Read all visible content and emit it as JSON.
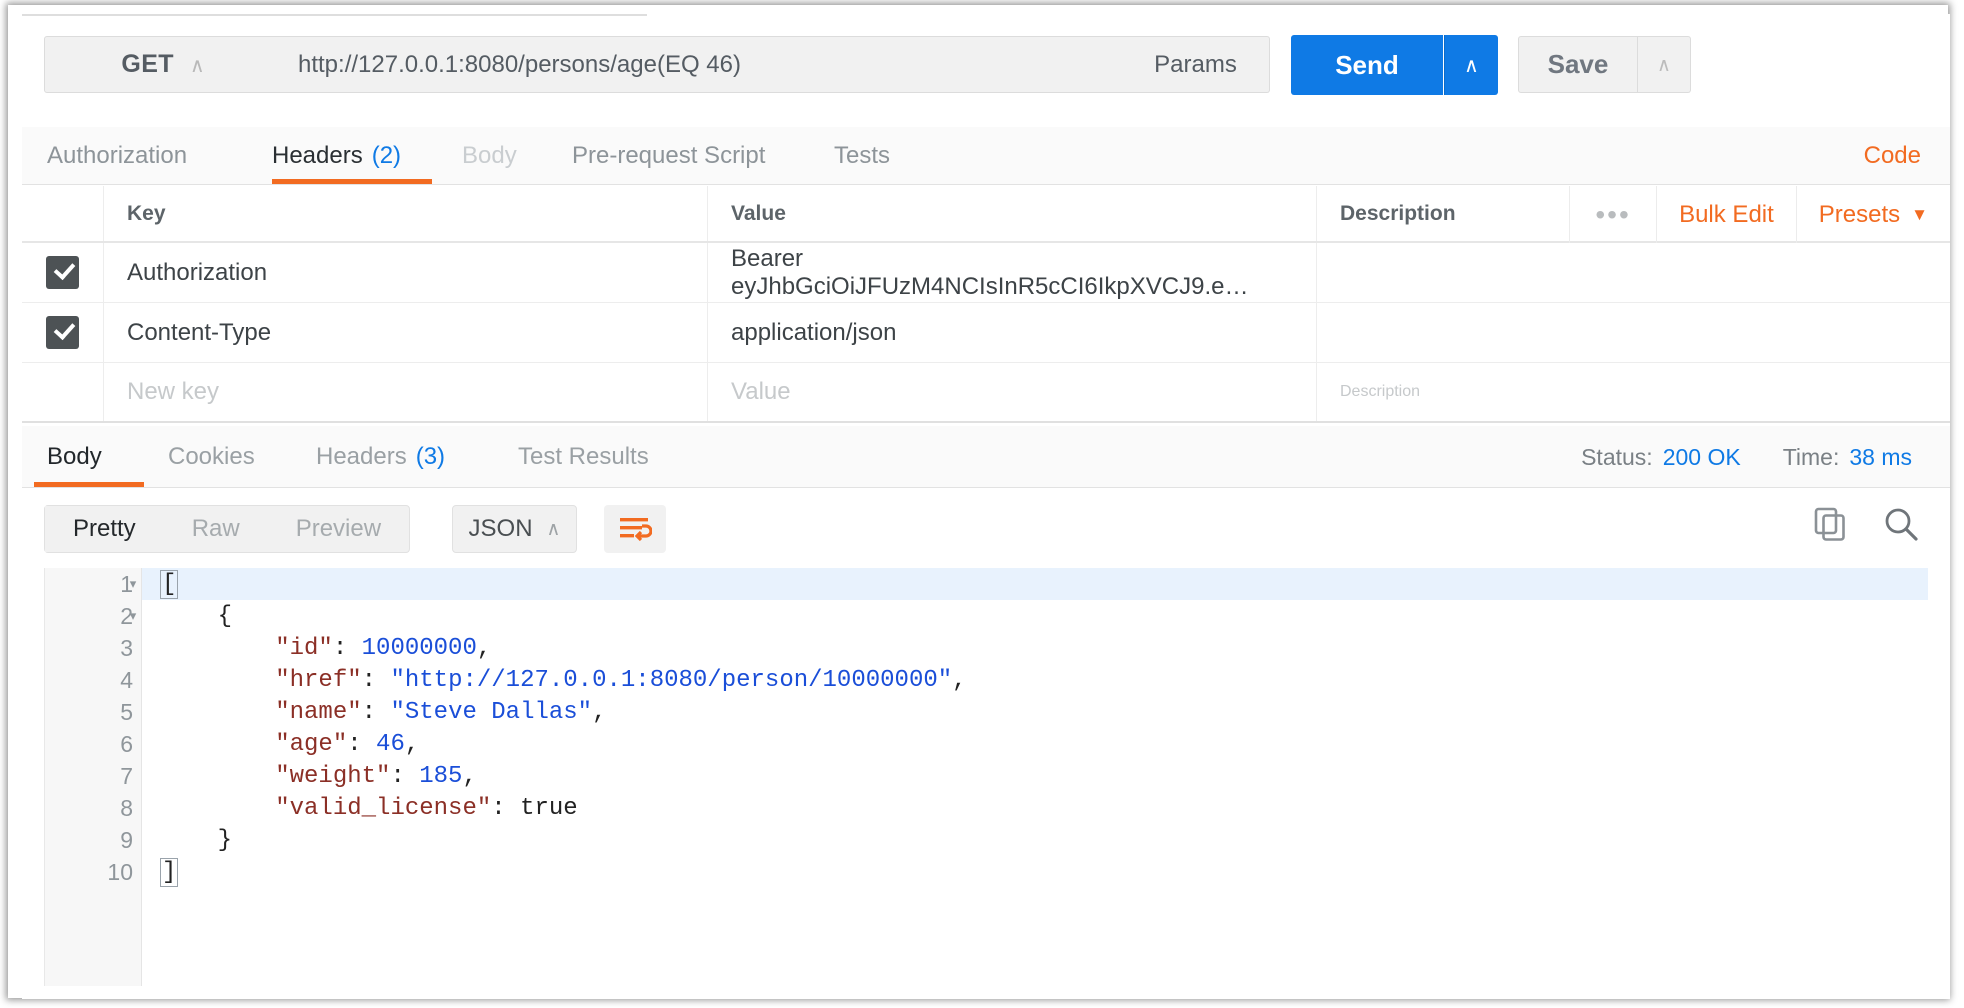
{
  "request": {
    "method": "GET",
    "url": "http://127.0.0.1:8080/persons/age(EQ 46)",
    "params_label": "Params",
    "send_label": "Send",
    "save_label": "Save",
    "tabs": [
      {
        "label": "Authorization",
        "count": "",
        "state": "normal"
      },
      {
        "label": "Headers",
        "count": "(2)",
        "state": "active"
      },
      {
        "label": "Body",
        "count": "",
        "state": "disabled"
      },
      {
        "label": "Pre-request Script",
        "count": "",
        "state": "normal"
      },
      {
        "label": "Tests",
        "count": "",
        "state": "normal"
      }
    ],
    "code_link": "Code"
  },
  "headers_table": {
    "columns": [
      "Key",
      "Value",
      "Description"
    ],
    "rows": [
      {
        "checked": true,
        "key": "Authorization",
        "value": "Bearer eyJhbGciOiJFUzM4NCIsInR5cCI6IkpXVCJ9.e…",
        "description": ""
      },
      {
        "checked": true,
        "key": "Content-Type",
        "value": "application/json",
        "description": ""
      }
    ],
    "new_row": {
      "key_placeholder": "New key",
      "value_placeholder": "Value",
      "description_placeholder": "Description"
    },
    "tools": {
      "more_dots": "•••",
      "bulk_edit": "Bulk Edit",
      "presets": "Presets",
      "presets_caret": "▼"
    }
  },
  "response": {
    "tabs": [
      {
        "label": "Body",
        "count": "",
        "state": "active"
      },
      {
        "label": "Cookies",
        "count": "",
        "state": "normal"
      },
      {
        "label": "Headers",
        "count": "(3)",
        "state": "normal"
      },
      {
        "label": "Test Results",
        "count": "",
        "state": "normal"
      }
    ],
    "status_label": "Status:",
    "status_value": "200 OK",
    "time_label": "Time:",
    "time_value": "38 ms",
    "view_modes": [
      "Pretty",
      "Raw",
      "Preview"
    ],
    "active_view_mode": "Pretty",
    "format": "JSON",
    "icons": {
      "wrap": "word-wrap-icon",
      "copy": "copy-icon",
      "search": "search-icon"
    }
  },
  "code": {
    "language": "json",
    "lines": [
      {
        "no": "1",
        "fold": "▾",
        "highlight": true,
        "tokens": [
          {
            "t": "[",
            "c": "cursor"
          }
        ]
      },
      {
        "no": "2",
        "fold": "▾",
        "highlight": false,
        "tokens": [
          {
            "t": "    {",
            "c": "p"
          }
        ]
      },
      {
        "no": "3",
        "fold": "",
        "highlight": false,
        "tokens": [
          {
            "t": "        ",
            "c": "p"
          },
          {
            "t": "\"id\"",
            "c": "k"
          },
          {
            "t": ": ",
            "c": "p"
          },
          {
            "t": "10000000",
            "c": "n"
          },
          {
            "t": ",",
            "c": "p"
          }
        ]
      },
      {
        "no": "4",
        "fold": "",
        "highlight": false,
        "tokens": [
          {
            "t": "        ",
            "c": "p"
          },
          {
            "t": "\"href\"",
            "c": "k"
          },
          {
            "t": ": ",
            "c": "p"
          },
          {
            "t": "\"http://127.0.0.1:8080/person/10000000\"",
            "c": "s"
          },
          {
            "t": ",",
            "c": "p"
          }
        ]
      },
      {
        "no": "5",
        "fold": "",
        "highlight": false,
        "tokens": [
          {
            "t": "        ",
            "c": "p"
          },
          {
            "t": "\"name\"",
            "c": "k"
          },
          {
            "t": ": ",
            "c": "p"
          },
          {
            "t": "\"Steve Dallas\"",
            "c": "s"
          },
          {
            "t": ",",
            "c": "p"
          }
        ]
      },
      {
        "no": "6",
        "fold": "",
        "highlight": false,
        "tokens": [
          {
            "t": "        ",
            "c": "p"
          },
          {
            "t": "\"age\"",
            "c": "k"
          },
          {
            "t": ": ",
            "c": "p"
          },
          {
            "t": "46",
            "c": "n"
          },
          {
            "t": ",",
            "c": "p"
          }
        ]
      },
      {
        "no": "7",
        "fold": "",
        "highlight": false,
        "tokens": [
          {
            "t": "        ",
            "c": "p"
          },
          {
            "t": "\"weight\"",
            "c": "k"
          },
          {
            "t": ": ",
            "c": "p"
          },
          {
            "t": "185",
            "c": "n"
          },
          {
            "t": ",",
            "c": "p"
          }
        ]
      },
      {
        "no": "8",
        "fold": "",
        "highlight": false,
        "tokens": [
          {
            "t": "        ",
            "c": "p"
          },
          {
            "t": "\"valid_license\"",
            "c": "k"
          },
          {
            "t": ": ",
            "c": "p"
          },
          {
            "t": "true",
            "c": "b"
          }
        ]
      },
      {
        "no": "9",
        "fold": "",
        "highlight": false,
        "tokens": [
          {
            "t": "    }",
            "c": "p"
          }
        ]
      },
      {
        "no": "10",
        "fold": "",
        "highlight": false,
        "tokens": [
          {
            "t": "]",
            "c": "cursor"
          }
        ]
      }
    ],
    "json_value": [
      {
        "id": 10000000,
        "href": "http://127.0.0.1:8080/person/10000000",
        "name": "Steve Dallas",
        "age": 46,
        "weight": 185,
        "valid_license": true
      }
    ]
  },
  "colors": {
    "accent_orange": "#f26b21",
    "accent_blue": "#0f7ae5",
    "checkbox": "#4d5255",
    "json_key": "#8b2f26",
    "json_string": "#1a4ed8"
  }
}
